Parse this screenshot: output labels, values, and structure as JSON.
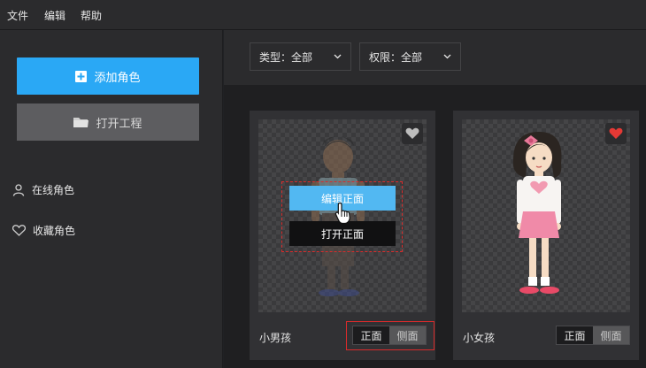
{
  "menu": {
    "file": "文件",
    "edit": "编辑",
    "help": "帮助"
  },
  "sidebar": {
    "add_role": "添加角色",
    "open_project": "打开工程",
    "online_roles": "在线角色",
    "fav_roles": "收藏角色"
  },
  "filters": {
    "type_label": "类型：全部",
    "permission_label": "权限：全部"
  },
  "cards": [
    {
      "name": "小男孩",
      "front": "正面",
      "side": "侧面",
      "favorited": false
    },
    {
      "name": "小女孩",
      "front": "正面",
      "side": "侧面",
      "favorited": true
    }
  ],
  "overlay": {
    "edit_front": "编辑正面",
    "open_front": "打开正面"
  },
  "colors": {
    "accent": "#2aa8f5",
    "heart_active": "#e53935",
    "highlight": "#d92b2b"
  }
}
